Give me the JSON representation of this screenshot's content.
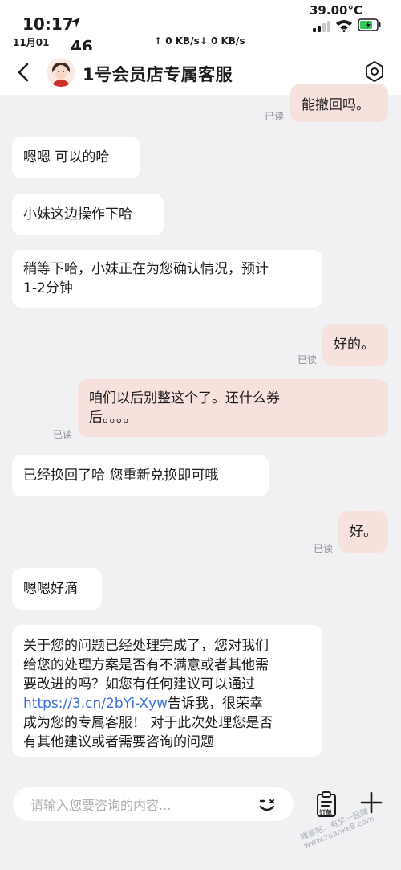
{
  "status_bar": {
    "time": "10:17",
    "date": "11月01",
    "number": "46",
    "network_speed": "↑ 0 KB/s↓ 0 KB/s",
    "temperature": "39.00°C"
  },
  "header": {
    "title": "1号会员店专属客服"
  },
  "messages": [
    {
      "side": "right",
      "text": "能撤回吗。",
      "read": "已读"
    },
    {
      "side": "left",
      "text": "嗯嗯 可以的哈"
    },
    {
      "side": "left",
      "text": "小妹这边操作下哈"
    },
    {
      "side": "left",
      "line1": "稍等下哈，小妹正在为您确认情况，预计",
      "line2": "1-2分钟"
    },
    {
      "side": "right",
      "text": "好的。",
      "read": "已读"
    },
    {
      "side": "right",
      "line1": "咱们以后别整这个了。还什么券",
      "line2": "后。。。。",
      "read": "已读"
    },
    {
      "side": "left",
      "text": "已经换回了哈 您重新兑换即可哦"
    },
    {
      "side": "right",
      "text": "好。",
      "read": "已读"
    },
    {
      "side": "left",
      "text": "嗯嗯好滴"
    },
    {
      "side": "left",
      "line1": "关于您的问题已经处理完成了，您对我们",
      "line2": "给您的处理方案是否有不满意或者其他需",
      "line3": "要改进的吗？如您有任何建议可以通过",
      "link": "https://3.cn/2bYi-Xyw",
      "line4_rest": "告诉我，很荣幸",
      "line5": "成为您的专属客服！ 对于此次处理您是否",
      "line6": "有其他建议或者需要咨询的问题"
    }
  ],
  "input": {
    "placeholder": "请输入您要咨询的内容...",
    "order_label": "订单"
  },
  "watermark": "赚客吧，有奖一起赚 www.zuanke8.com",
  "colors": {
    "background": "#f1f1f3",
    "left_bubble": "#ffffff",
    "right_bubble": "#f7e1dd",
    "link": "#3a6fd8"
  },
  "icons": [
    "location-arrow-icon",
    "signal-icon",
    "wifi-icon",
    "battery-icon",
    "back-chevron-icon",
    "settings-hexagon-icon",
    "emoji-icon",
    "order-clipboard-icon",
    "plus-icon"
  ]
}
